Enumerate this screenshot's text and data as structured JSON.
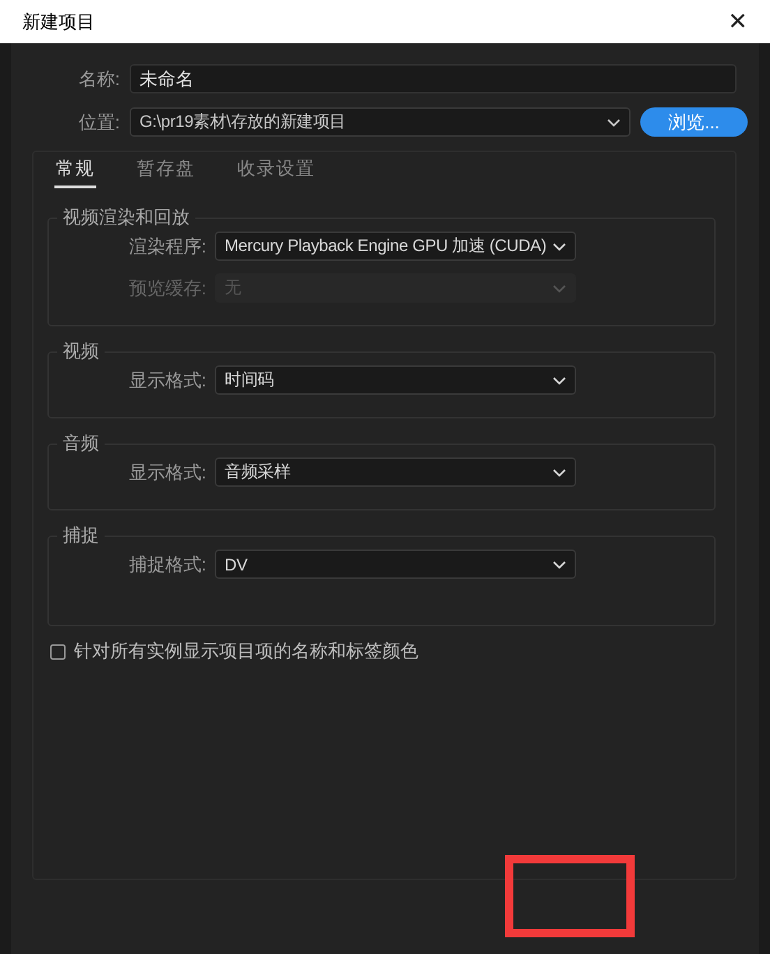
{
  "window": {
    "title": "新建项目",
    "close": "✕"
  },
  "fields": [
    {
      "label": "名称:",
      "value": "未命名",
      "kind": "text"
    },
    {
      "label": "位置:",
      "value": "G:\\pr19素材\\存放的新建项目",
      "kind": "dropdown"
    }
  ],
  "browse_button": "浏览...",
  "tabs": [
    {
      "label": "常规",
      "selected": true
    },
    {
      "label": "暂存盘",
      "selected": false
    },
    {
      "label": "收录设置",
      "selected": false
    }
  ],
  "groups": [
    {
      "title": "视频渲染和回放",
      "rows": [
        {
          "label": "渲染程序:",
          "value": "Mercury Playback Engine GPU 加速 (CUDA)",
          "disabled": false
        },
        {
          "label": "预览缓存:",
          "value": "无",
          "disabled": true
        }
      ]
    },
    {
      "title": "视频",
      "rows": [
        {
          "label": "显示格式:",
          "value": "时间码",
          "disabled": false
        }
      ]
    },
    {
      "title": "音频",
      "rows": [
        {
          "label": "显示格式:",
          "value": "音频采样",
          "disabled": false
        }
      ]
    },
    {
      "title": "捕捉",
      "rows": [
        {
          "label": "捕捉格式:",
          "value": "DV",
          "disabled": false
        }
      ]
    }
  ],
  "checkbox": {
    "label": "针对所有实例显示项目项的名称和标签颜色",
    "checked": false
  },
  "annotation": {
    "kind": "rectangle",
    "color": "#f23a3a"
  }
}
